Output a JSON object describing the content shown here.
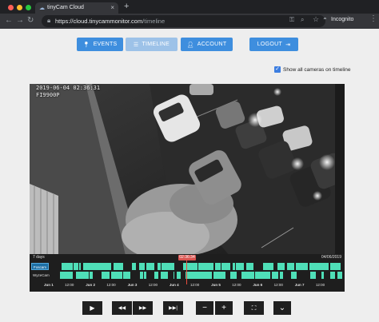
{
  "browser": {
    "tab_title": "tinyCam Cloud",
    "tab_close": "×",
    "new_tab": "+",
    "url_scheme": "https://cloud.tinycammonitor.com",
    "url_path": "/timeline",
    "incognito_label": "Incognito",
    "icons": [
      "back-arrow-icon",
      "forward-arrow-icon",
      "reload-icon",
      "lock-icon",
      "key-icon",
      "zoom-icon",
      "star-icon",
      "incognito-icon",
      "menu-icon"
    ]
  },
  "nav": {
    "events_label": "EVENTS",
    "timeline_label": "TIMELINE",
    "account_label": "ACCOUNT",
    "logout_label": "LOGOUT",
    "active": "timeline",
    "colors": {
      "button": "#3e8ede",
      "active_button": "#9dc2e8"
    }
  },
  "show_all_cameras": {
    "label": "Show all cameras on timeline",
    "checked": true
  },
  "video": {
    "timestamp": "2019-06-04 02:36:31",
    "camera_label": "FI9900P"
  },
  "timeline": {
    "range_label": "7 days",
    "end_date": "04/06/2019",
    "current_time": "02:36:34",
    "rows": [
      {
        "label": "Foscam"
      },
      {
        "label": "WyzeCam"
      }
    ],
    "ticks": [
      {
        "text": "Jun 1",
        "day": true
      },
      {
        "text": "12:00",
        "day": false
      },
      {
        "text": "Jun 2",
        "day": true
      },
      {
        "text": "12:00",
        "day": false
      },
      {
        "text": "Jun 3",
        "day": true
      },
      {
        "text": "12:00",
        "day": false
      },
      {
        "text": "Jun 4",
        "day": true
      },
      {
        "text": "12:00",
        "day": false
      },
      {
        "text": "Jun 5",
        "day": true
      },
      {
        "text": "12:00",
        "day": false
      },
      {
        "text": "Jun 6",
        "day": true
      },
      {
        "text": "12:00",
        "day": false
      },
      {
        "text": "Jun 7",
        "day": true
      },
      {
        "text": "12:00",
        "day": false
      }
    ],
    "colors": {
      "recording": "#4fdfb8",
      "playhead": "#e84c3d"
    }
  },
  "controls": [
    {
      "name": "play-button",
      "icon": "play-icon",
      "glyph": "▶"
    },
    {
      "name": "rewind-button",
      "icon": "rewind-icon",
      "glyph": "◀◀"
    },
    {
      "name": "fast-forward-button",
      "icon": "fast-forward-icon",
      "glyph": "▶▶"
    },
    {
      "name": "skip-next-button",
      "icon": "skip-next-icon",
      "glyph": "▶▶|"
    },
    {
      "name": "zoom-out-button",
      "icon": "minus-icon",
      "glyph": "−"
    },
    {
      "name": "zoom-in-button",
      "icon": "plus-icon",
      "glyph": "+"
    },
    {
      "name": "fullscreen-button",
      "icon": "fullscreen-icon",
      "glyph": "⛶"
    },
    {
      "name": "more-button",
      "icon": "chevron-down-icon",
      "glyph": "⌄"
    }
  ]
}
